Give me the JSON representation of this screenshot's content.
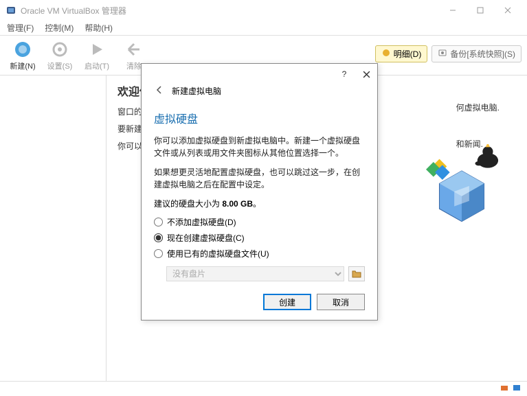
{
  "window": {
    "title": "Oracle VM VirtualBox 管理器"
  },
  "menu": {
    "file": "管理(F)",
    "control": "控制(M)",
    "help": "帮助(H)"
  },
  "toolbar": {
    "new": "新建(N)",
    "settings": "设置(S)",
    "start": "启动(T)",
    "discard": "清除",
    "detail": "明细(D)",
    "snapshot": "备份[系统快照](S)"
  },
  "content": {
    "welcome": "欢迎使",
    "line1": "窗口的左",
    "line2": "要新建一",
    "line3": "你可以按",
    "right1": "何虚拟电脑.",
    "right2": "和新闻."
  },
  "dialog": {
    "header": "新建虚拟电脑",
    "title": "虚拟硬盘",
    "para1": "你可以添加虚拟硬盘到新虚拟电脑中。新建一个虚拟硬盘文件或从列表或用文件夹图标从其他位置选择一个。",
    "para2": "如果想更灵活地配置虚拟硬盘，也可以跳过这一步，在创建虚拟电脑之后在配置中设定。",
    "recommend_prefix": "建议的硬盘大小为 ",
    "recommend_size": "8.00 GB",
    "recommend_suffix": "。",
    "radio1": "不添加虚拟硬盘(D)",
    "radio2": "现在创建虚拟硬盘(C)",
    "radio3": "使用已有的虚拟硬盘文件(U)",
    "select_empty": "没有盘片",
    "create": "创建",
    "cancel": "取消"
  }
}
